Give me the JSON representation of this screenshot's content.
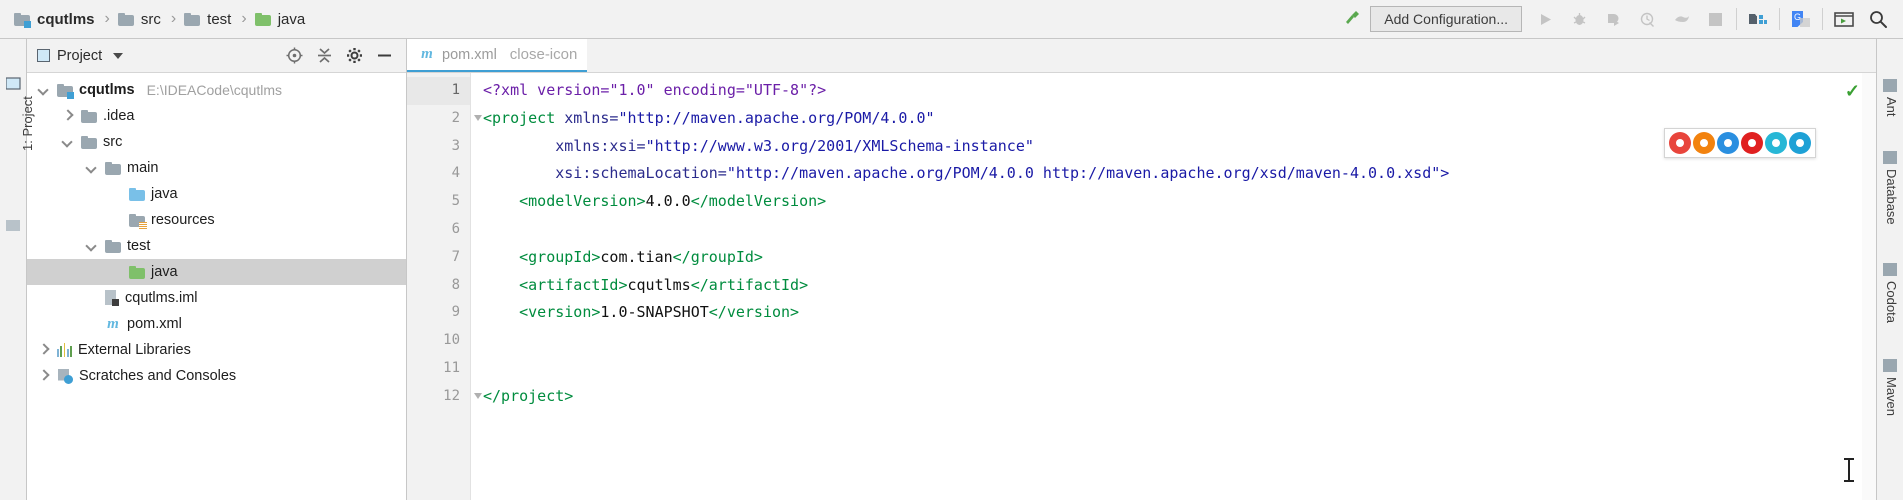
{
  "breadcrumb": [
    {
      "label": "cqutlms",
      "icon": "folder-module-icon",
      "style": "gray-badge",
      "bold": true
    },
    {
      "label": "src",
      "icon": "folder-icon",
      "style": "gray",
      "bold": false
    },
    {
      "label": "test",
      "icon": "folder-icon",
      "style": "gray",
      "bold": false
    },
    {
      "label": "java",
      "icon": "folder-test-source-icon",
      "style": "green",
      "bold": false
    }
  ],
  "toolbar": {
    "build_icon": "hammer-icon",
    "add_configuration_label": "Add Configuration...",
    "run_icon": "run-icon",
    "debug_icon": "debug-icon",
    "run_coverage_icon": "run-with-coverage-icon",
    "profile_icon": "profile-icon",
    "attach_icon": "attach-debugger-icon",
    "stop_icon": "stop-icon",
    "project_structure_icon": "project-structure-icon",
    "translate_icon": "google-translate-icon",
    "presentation_icon": "presentation-window-icon",
    "search_icon": "search-everywhere-icon"
  },
  "left_strip": {
    "tabs": [
      {
        "label": "1: Project",
        "icon": "project-tool-icon"
      }
    ],
    "structure_icon": "structure-icon"
  },
  "project_panel": {
    "title": "Project",
    "title_icon": "project-view-icon",
    "dropdown_icon": "chevron-down-icon",
    "actions": [
      {
        "name": "select-opened-file-icon",
        "label": "locate"
      },
      {
        "name": "collapse-all-icon",
        "label": "collapse"
      },
      {
        "name": "gear-icon",
        "label": "settings"
      },
      {
        "name": "hide-icon",
        "label": "hide"
      }
    ],
    "tree": [
      {
        "label": "cqutlms",
        "secondary": "E:\\IDEACode\\cqutlms",
        "indent": 0,
        "arrow": "down",
        "icon": "folder-module-icon",
        "color": "gray",
        "badge": true,
        "bold": true,
        "selected": false
      },
      {
        "label": ".idea",
        "secondary": "",
        "indent": 1,
        "arrow": "right",
        "icon": "folder-icon",
        "color": "gray",
        "badge": false,
        "bold": false,
        "selected": false
      },
      {
        "label": "src",
        "secondary": "",
        "indent": 1,
        "arrow": "down",
        "icon": "folder-icon",
        "color": "gray",
        "badge": false,
        "bold": false,
        "selected": false
      },
      {
        "label": "main",
        "secondary": "",
        "indent": 2,
        "arrow": "down",
        "icon": "folder-icon",
        "color": "gray",
        "badge": false,
        "bold": false,
        "selected": false
      },
      {
        "label": "java",
        "secondary": "",
        "indent": 3,
        "arrow": "none",
        "icon": "folder-source-icon",
        "color": "blue",
        "badge": false,
        "bold": false,
        "selected": false
      },
      {
        "label": "resources",
        "secondary": "",
        "indent": 3,
        "arrow": "none",
        "icon": "folder-resources-icon",
        "color": "gray",
        "badge": false,
        "lines": true,
        "bold": false,
        "selected": false
      },
      {
        "label": "test",
        "secondary": "",
        "indent": 2,
        "arrow": "down",
        "icon": "folder-icon",
        "color": "gray",
        "badge": false,
        "bold": false,
        "selected": false
      },
      {
        "label": "java",
        "secondary": "",
        "indent": 3,
        "arrow": "none",
        "icon": "folder-test-source-icon",
        "color": "green",
        "badge": false,
        "bold": false,
        "selected": true
      },
      {
        "label": "cqutlms.iml",
        "secondary": "",
        "indent": 2,
        "arrow": "none",
        "icon": "iml-file-icon",
        "color": "none",
        "badge": false,
        "bold": false,
        "selected": false
      },
      {
        "label": "pom.xml",
        "secondary": "",
        "indent": 2,
        "arrow": "none",
        "icon": "maven-file-icon",
        "color": "none",
        "badge": false,
        "bold": false,
        "selected": false
      },
      {
        "label": "External Libraries",
        "secondary": "",
        "indent": 0,
        "arrow": "right",
        "icon": "libraries-icon",
        "color": "none",
        "badge": false,
        "bold": false,
        "selected": false
      },
      {
        "label": "Scratches and Consoles",
        "secondary": "",
        "indent": 0,
        "arrow": "right",
        "icon": "scratches-icon",
        "color": "none",
        "badge": false,
        "bold": false,
        "selected": false
      }
    ]
  },
  "editor": {
    "tab": {
      "label": "pom.xml",
      "icon": "maven-file-icon",
      "close_icon": "close-icon"
    },
    "inspection_status": "✓",
    "line_numbers": [
      "1",
      "2",
      "3",
      "4",
      "5",
      "6",
      "7",
      "8",
      "9",
      "10",
      "11",
      "12"
    ],
    "current_line": 1,
    "browser_preview": [
      {
        "name": "chrome-icon",
        "color": "#e8453c"
      },
      {
        "name": "firefox-icon",
        "color": "#f2820e"
      },
      {
        "name": "safari-icon",
        "color": "#2a8fe0"
      },
      {
        "name": "opera-icon",
        "color": "#e02020"
      },
      {
        "name": "edge-legacy-icon",
        "color": "#27b7d6"
      },
      {
        "name": "edge-icon",
        "color": "#1ea1d6"
      }
    ],
    "lines": [
      [
        {
          "t": "<?xml version=",
          "c": "pi"
        },
        {
          "t": "\"1.0\"",
          "c": "pi"
        },
        {
          "t": " encoding=",
          "c": "pi"
        },
        {
          "t": "\"UTF-8\"",
          "c": "pi"
        },
        {
          "t": "?>",
          "c": "pi"
        }
      ],
      [
        {
          "t": "<project ",
          "c": "tg"
        },
        {
          "t": "xmlns=",
          "c": "at"
        },
        {
          "t": "\"http://maven.apache.org/POM/4.0.0\"",
          "c": "vl"
        }
      ],
      [
        {
          "t": "        ",
          "c": "txt"
        },
        {
          "t": "xmlns:xsi=",
          "c": "at"
        },
        {
          "t": "\"http://www.w3.org/2001/XMLSchema-instance\"",
          "c": "vl"
        }
      ],
      [
        {
          "t": "        ",
          "c": "txt"
        },
        {
          "t": "xsi:schemaLocation=",
          "c": "at"
        },
        {
          "t": "\"http://maven.apache.org/POM/4.0.0 http://maven.apache.org/xsd/maven-4.0.0.xsd\">",
          "c": "vl"
        }
      ],
      [
        {
          "t": "    ",
          "c": "txt"
        },
        {
          "t": "<modelVersion>",
          "c": "tg"
        },
        {
          "t": "4.0.0",
          "c": "txt"
        },
        {
          "t": "</modelVersion>",
          "c": "tg"
        }
      ],
      [],
      [
        {
          "t": "    ",
          "c": "txt"
        },
        {
          "t": "<groupId>",
          "c": "tg"
        },
        {
          "t": "com.tian",
          "c": "txt"
        },
        {
          "t": "</groupId>",
          "c": "tg"
        }
      ],
      [
        {
          "t": "    ",
          "c": "txt"
        },
        {
          "t": "<artifactId>",
          "c": "tg"
        },
        {
          "t": "cqutlms",
          "c": "txt"
        },
        {
          "t": "</artifactId>",
          "c": "tg"
        }
      ],
      [
        {
          "t": "    ",
          "c": "txt"
        },
        {
          "t": "<version>",
          "c": "tg"
        },
        {
          "t": "1.0-SNAPSHOT",
          "c": "txt"
        },
        {
          "t": "</version>",
          "c": "tg"
        }
      ],
      [],
      [],
      [
        {
          "t": "</project>",
          "c": "tg"
        }
      ]
    ]
  },
  "right_strip": {
    "tabs": [
      {
        "label": "Ant",
        "icon": "ant-icon"
      },
      {
        "label": "Database",
        "icon": "database-icon"
      },
      {
        "label": "Codota",
        "icon": "codota-icon"
      },
      {
        "label": "Maven",
        "icon": "maven-icon"
      }
    ]
  },
  "colors": {
    "accent": "#3f9fd4",
    "tag": "#008c3e",
    "attr": "#2b2b8c",
    "value": "#1a1aa6",
    "pi": "#6b1fa8",
    "ok": "#3aa033"
  }
}
